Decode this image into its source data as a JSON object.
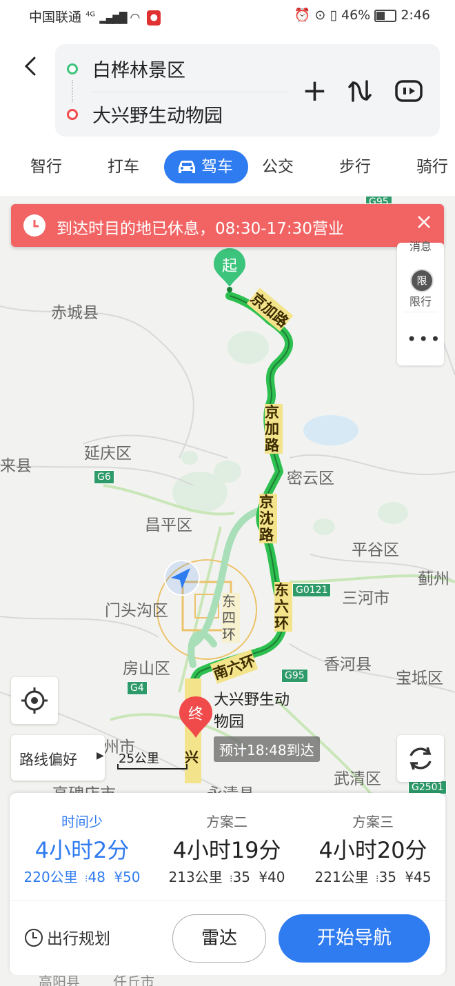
{
  "status_bar": {
    "carrier": "中国联通",
    "network": "4G",
    "battery": "46%",
    "time": "2:46"
  },
  "header": {
    "origin": "白桦林景区",
    "destination": "大兴野生动物园"
  },
  "tabs": [
    {
      "label": "智行"
    },
    {
      "label": "打车"
    },
    {
      "label": "驾车"
    },
    {
      "label": "公交"
    },
    {
      "label": "步行"
    },
    {
      "label": "骑行"
    }
  ],
  "active_tab": "驾车",
  "alert": {
    "text": "到达时目的地已休息，08:30-17:30营业"
  },
  "side_panel": {
    "item1": "消息",
    "item2": "限行",
    "badge": "限"
  },
  "map": {
    "labels": {
      "chicheng": "赤城县",
      "yanqing": "延庆区",
      "laixian": "来县",
      "miyun": "密云区",
      "changping": "昌平区",
      "pinggu": "平谷区",
      "jizhou": "蓟州",
      "mentougou": "门头沟区",
      "sanhe": "三河市",
      "fangshan": "房山区",
      "xianghe": "香河县",
      "baodi": "宝坻区",
      "zhuozhou": "州市",
      "wuqing": "武清区",
      "gaobeidian": "高碑店市",
      "yongqing": "永清县",
      "gaoyang": "高阳县",
      "renqiu": "任丘市"
    },
    "road_labels": {
      "jingjia1": "京加路",
      "jingjia2": "京加路",
      "jingshen": "京沈路",
      "dongliuhuan": "东六环",
      "dongsihuan": "东四环",
      "nanliuhuan": "南六环",
      "daxing": "大兴",
      "g6": "G6",
      "g4": "G4",
      "g0121": "G0121",
      "g95": "G95",
      "g2501": "G2501",
      "g95_top": "G95"
    },
    "start_marker": "起",
    "end_marker": "终",
    "destination_label_line1": "大兴野生动",
    "destination_label_line2": "物园",
    "eta_label": "预计18:48到达",
    "scale": "25公里"
  },
  "buttons": {
    "route_preference": "路线偏好",
    "plan_trip": "出行规划",
    "radar": "雷达",
    "start_navigation": "开始导航"
  },
  "plans": [
    {
      "label": "时间少",
      "time": "4小时2分",
      "distance": "220公里",
      "lights": "48",
      "toll": "¥50",
      "selected": true
    },
    {
      "label": "方案二",
      "time": "4小时19分",
      "distance": "213公里",
      "lights": "35",
      "toll": "¥40",
      "selected": false
    },
    {
      "label": "方案三",
      "time": "4小时20分",
      "distance": "221公里",
      "lights": "35",
      "toll": "¥45",
      "selected": false
    }
  ],
  "colors": {
    "accent": "#2f7bf0",
    "route": "#2dbf4f",
    "alert": "#f26464",
    "start": "#3cc47c",
    "end": "#f04a4a"
  }
}
